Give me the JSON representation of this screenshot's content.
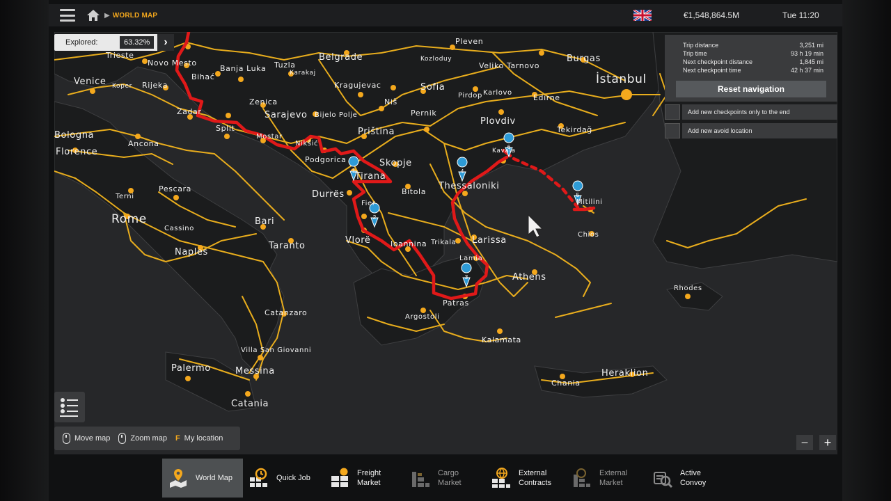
{
  "topbar": {
    "breadcrumb": "WORLD MAP",
    "money": "€1,548,864.5M",
    "clock": "Tue 11:20"
  },
  "explored": {
    "label": "Explored:",
    "value": "63.32%"
  },
  "trip": {
    "rows": [
      {
        "label": "Trip distance",
        "value": "3,251 mi"
      },
      {
        "label": "Trip time",
        "value": "93 h 19 min"
      },
      {
        "label": "Next checkpoint distance",
        "value": "1,845 mi"
      },
      {
        "label": "Next checkpoint time",
        "value": "42 h 37 min"
      }
    ],
    "reset_label": "Reset navigation"
  },
  "options": {
    "checkpoints_end": "Add new checkpoints only to the end",
    "avoid_location": "Add new avoid location"
  },
  "controls": {
    "move": "Move map",
    "zoom": "Zoom map",
    "key": "F",
    "my_location": "My location"
  },
  "zoom": {
    "minus": "−",
    "plus": "+"
  },
  "tabs": [
    {
      "label": "World Map"
    },
    {
      "label": "Quick Job"
    },
    {
      "label": "Freight\nMarket"
    },
    {
      "label": "Cargo\nMarket"
    },
    {
      "label": "External\nContracts"
    },
    {
      "label": "External\nMarket"
    },
    {
      "label": "Active\nConvoy"
    }
  ],
  "cities": [
    "Trieste",
    "Novo Mesto",
    "Venice",
    "Koper",
    "Rijeka",
    "Bihać",
    "Banja Luka",
    "Tuzla",
    "Karakaj",
    "Belgrade",
    "Kozloduy",
    "Pleven",
    "Veliko Tarnovo",
    "Burgas",
    "İstanbul",
    "Zenica",
    "Kragujevac",
    "Sofia",
    "Pirdop",
    "Karlovo",
    "Edirne",
    "Niš",
    "Sarajevo",
    "Bijelo Polje",
    "Zadar",
    "Split",
    "Mostar",
    "Nikšić",
    "Priština",
    "Pernik",
    "Plovdiv",
    "Tekirdağ",
    "Bologna",
    "Florence",
    "Ancona",
    "Podgorica",
    "Tirana",
    "Skopje",
    "Kavala",
    "Durrës",
    "Bitola",
    "Thessaloniki",
    "Mitilini",
    "Terni",
    "Pescara",
    "Fier",
    "Rome",
    "Cassino",
    "Bari",
    "Vlorë",
    "Ioannina",
    "Trikala",
    "Larissa",
    "Chios",
    "Naples",
    "Taranto",
    "Lamia",
    "Athens",
    "Rhodes",
    "Patras",
    "Catanzaro",
    "Argostoli",
    "Kalamata",
    "Villa San Giovanni",
    "Palermo",
    "Messina",
    "Chania",
    "Heraklion",
    "Catania"
  ],
  "checkpoints": [
    "1",
    "2",
    "3",
    "4",
    "5",
    "6"
  ]
}
